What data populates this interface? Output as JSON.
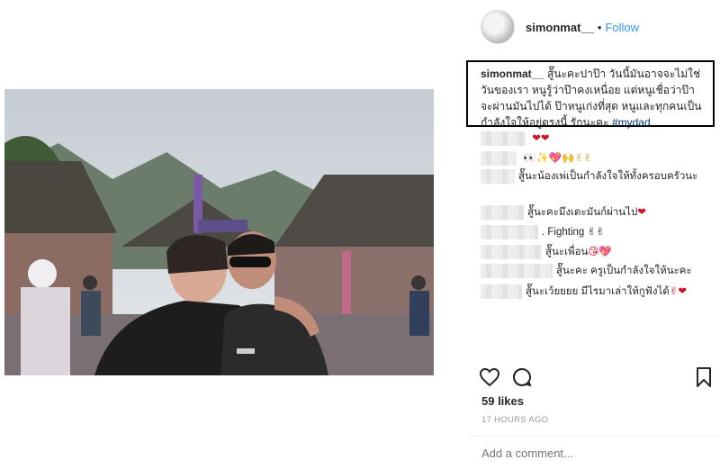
{
  "post": {
    "username": "simonmat__",
    "separator": "•",
    "follow_label": "Follow",
    "caption_user": "simonmat__",
    "caption_text": "สู้๊นะคะปาป๊า วันนี้มันอาจจะไม่ใช่วันของเรา หนูรู้ว่าป๊าคงเหนื่อย แต่หนูเชื่อว่าป๊าจะผ่านมันไปได้ ป๊าหนูเก่งที่สุด หนูและทุกคนเป็นกำลังใจให้อยู่ตรงนี้ รักนะคะ",
    "caption_tag": "#mydad"
  },
  "comments": [
    {
      "text": "",
      "emoji": "❤❤"
    },
    {
      "text": "",
      "emoji": "👀✨💖🙌✌✌"
    },
    {
      "text": "สู้๊นะน้องเพ่เป็นกำลังใจให้ทั้งครอบครัวนะ",
      "emoji": ""
    },
    {
      "text": "สู้๊นะคะมึงเดะมันก์ผ่านไป",
      "emoji": "❤"
    },
    {
      "text": ". Fighting",
      "emoji": "✌✌"
    },
    {
      "text": "สู้๊นะเพื่อน",
      "emoji": "😘💖"
    },
    {
      "text": "สู้๊นะคะ ครูเป็นกำลังใจให้นะคะ",
      "emoji": ""
    },
    {
      "text": "สู้๊นะเว้ยยยย มีไรมาเล่าให้กูฟังได้",
      "emoji": "✌❤"
    }
  ],
  "footer": {
    "likes": "59 likes",
    "time": "17 HOURS AGO",
    "comment_placeholder": "Add a comment..."
  },
  "icons": {
    "like": "heart-outline-icon",
    "comment": "speech-bubble-icon",
    "save": "bookmark-icon"
  },
  "colors": {
    "link": "#3897f0",
    "hashtag": "#003569",
    "heart": "#d0112b"
  }
}
